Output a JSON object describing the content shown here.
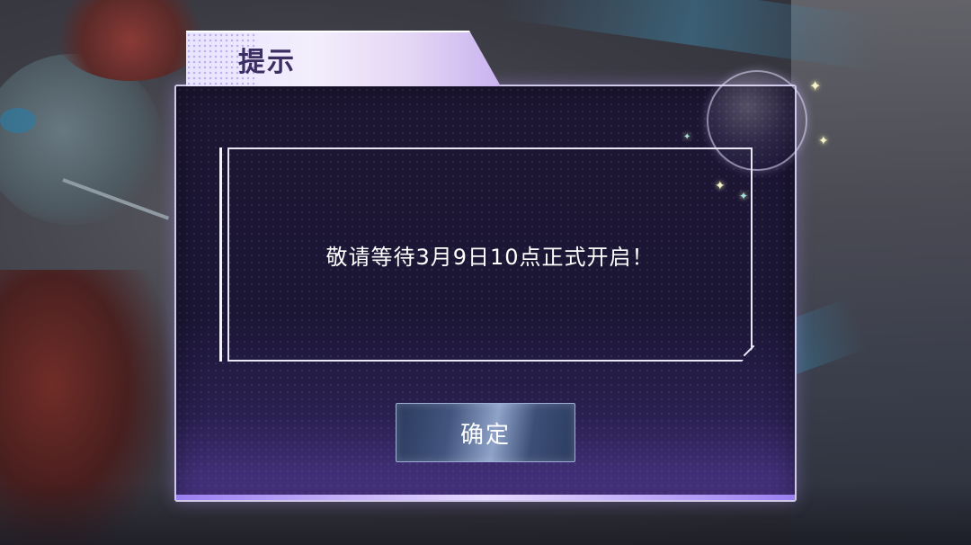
{
  "dialog": {
    "title": "提示",
    "message": "敬请等待3月9日10点正式开启！",
    "confirm_label": "确定"
  },
  "colors": {
    "dialog_bg": "#1c1632",
    "dialog_border": "#cfc8e6",
    "title_tab": "#ece6ff",
    "title_text": "#3a2e63",
    "button": "#43557e"
  },
  "icons": {
    "sparkle": "✦"
  }
}
